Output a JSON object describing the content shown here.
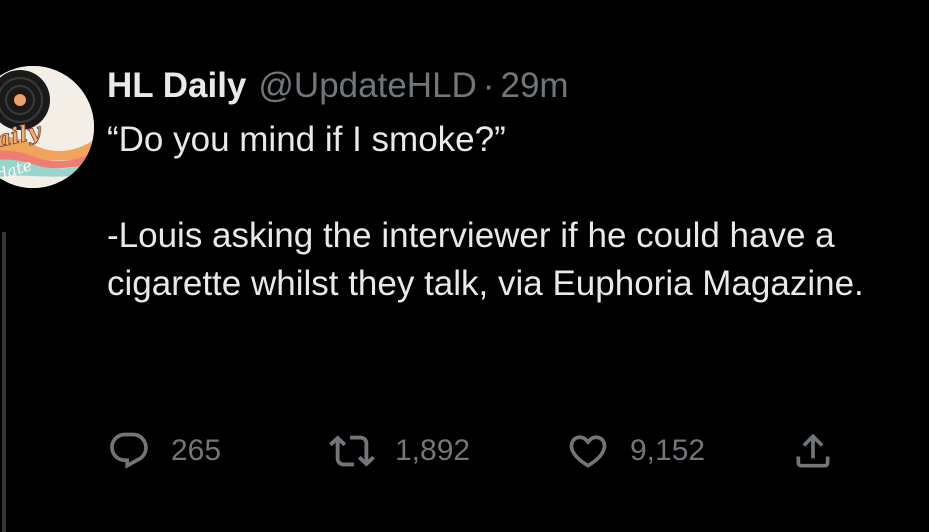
{
  "tweet": {
    "display_name": "HL Daily",
    "handle": "@UpdateHLD",
    "separator": "·",
    "timestamp": "29m",
    "text_quote": "“Do you mind if I smoke?”",
    "text_caption": "-Louis asking the interviewer if he could have a cigarette whilst they talk, via Euphoria Magazine."
  },
  "avatar": {
    "logo_lettering": [
      "Daily",
      "update"
    ]
  },
  "actions": {
    "reply_count": "265",
    "retweet_count": "1,892",
    "like_count": "9,152"
  },
  "icons": {
    "reply": "reply-icon",
    "retweet": "retweet-icon",
    "like": "like-icon",
    "share": "share-icon"
  },
  "colors": {
    "background": "#000000",
    "primary_text": "#e7e9ea",
    "secondary_text": "#71767b",
    "thread_line": "#333639"
  }
}
